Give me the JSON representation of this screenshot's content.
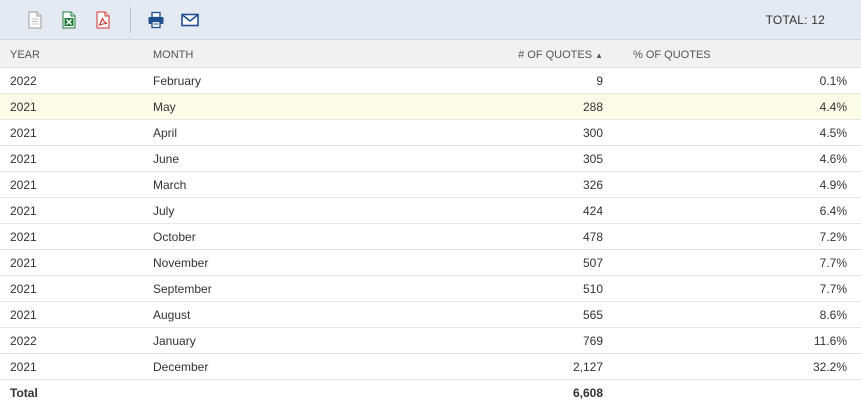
{
  "toolbar": {
    "icons": [
      "document-icon",
      "excel-icon",
      "pdf-icon",
      "print-icon",
      "email-icon"
    ],
    "total_label": "TOTAL: 12"
  },
  "table": {
    "headers": {
      "year": "YEAR",
      "month": "MONTH",
      "count": "# OF QUOTES",
      "sort_indicator": "▲",
      "pct": "% OF QUOTES"
    },
    "rows": [
      {
        "year": "2022",
        "month": "February",
        "count": "9",
        "pct": "0.1%"
      },
      {
        "year": "2021",
        "month": "May",
        "count": "288",
        "pct": "4.4%"
      },
      {
        "year": "2021",
        "month": "April",
        "count": "300",
        "pct": "4.5%"
      },
      {
        "year": "2021",
        "month": "June",
        "count": "305",
        "pct": "4.6%"
      },
      {
        "year": "2021",
        "month": "March",
        "count": "326",
        "pct": "4.9%"
      },
      {
        "year": "2021",
        "month": "July",
        "count": "424",
        "pct": "6.4%"
      },
      {
        "year": "2021",
        "month": "October",
        "count": "478",
        "pct": "7.2%"
      },
      {
        "year": "2021",
        "month": "November",
        "count": "507",
        "pct": "7.7%"
      },
      {
        "year": "2021",
        "month": "September",
        "count": "510",
        "pct": "7.7%"
      },
      {
        "year": "2021",
        "month": "August",
        "count": "565",
        "pct": "8.6%"
      },
      {
        "year": "2022",
        "month": "January",
        "count": "769",
        "pct": "11.6%"
      },
      {
        "year": "2021",
        "month": "December",
        "count": "2,127",
        "pct": "32.2%"
      }
    ],
    "total": {
      "label": "Total",
      "count": "6,608"
    }
  },
  "colors": {
    "toolbar_bg": "#e4e9f2",
    "highlight_row": "#fbfce7",
    "excel_green": "#1e7b34",
    "pdf_red": "#d0312d",
    "print_blue": "#1f4f8f"
  }
}
